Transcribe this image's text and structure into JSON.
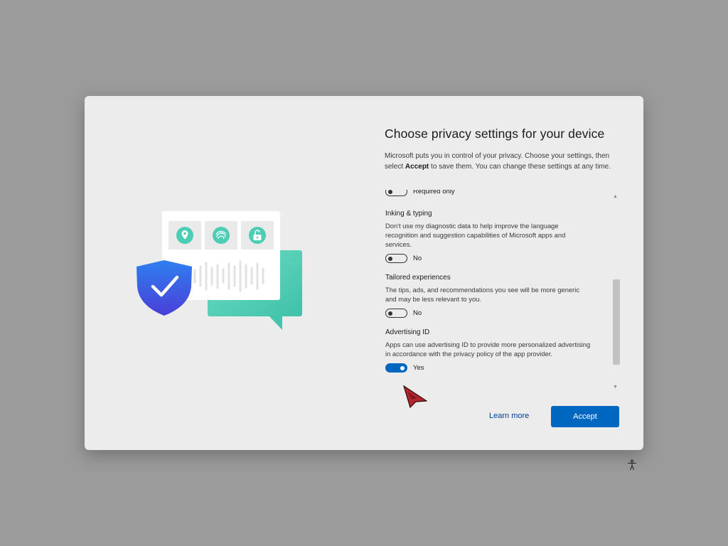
{
  "title": "Choose privacy settings for your device",
  "intro": {
    "part1": "Microsoft puts you in control of your privacy. Choose your settings, then select ",
    "bold": "Accept",
    "part2": " to save them. You can change these settings at any time."
  },
  "settings": [
    {
      "title": "",
      "description": "",
      "toggle_label": "Required only",
      "toggle_on": false
    },
    {
      "title": "Inking & typing",
      "description": "Don't use my diagnostic data to help improve the language recognition and suggestion capabilities of Microsoft apps and services.",
      "toggle_label": "No",
      "toggle_on": false
    },
    {
      "title": "Tailored experiences",
      "description": "The tips, ads, and recommendations you see will be more generic and may be less relevant to you.",
      "toggle_label": "No",
      "toggle_on": false
    },
    {
      "title": "Advertising ID",
      "description": "Apps can use advertising ID to provide more personalized advertising in accordance with the privacy policy of the app provider.",
      "toggle_label": "Yes",
      "toggle_on": true
    }
  ],
  "buttons": {
    "learn_more": "Learn more",
    "accept": "Accept"
  },
  "colors": {
    "accent": "#0067c0",
    "link": "#003e92",
    "teal": "#4ecfb6",
    "shield": "#3a5fe0"
  },
  "icons": [
    "shield-check-icon",
    "location-pin-icon",
    "fingerprint-icon",
    "unlock-icon",
    "accessibility-icon",
    "mouse-cursor-icon"
  ]
}
